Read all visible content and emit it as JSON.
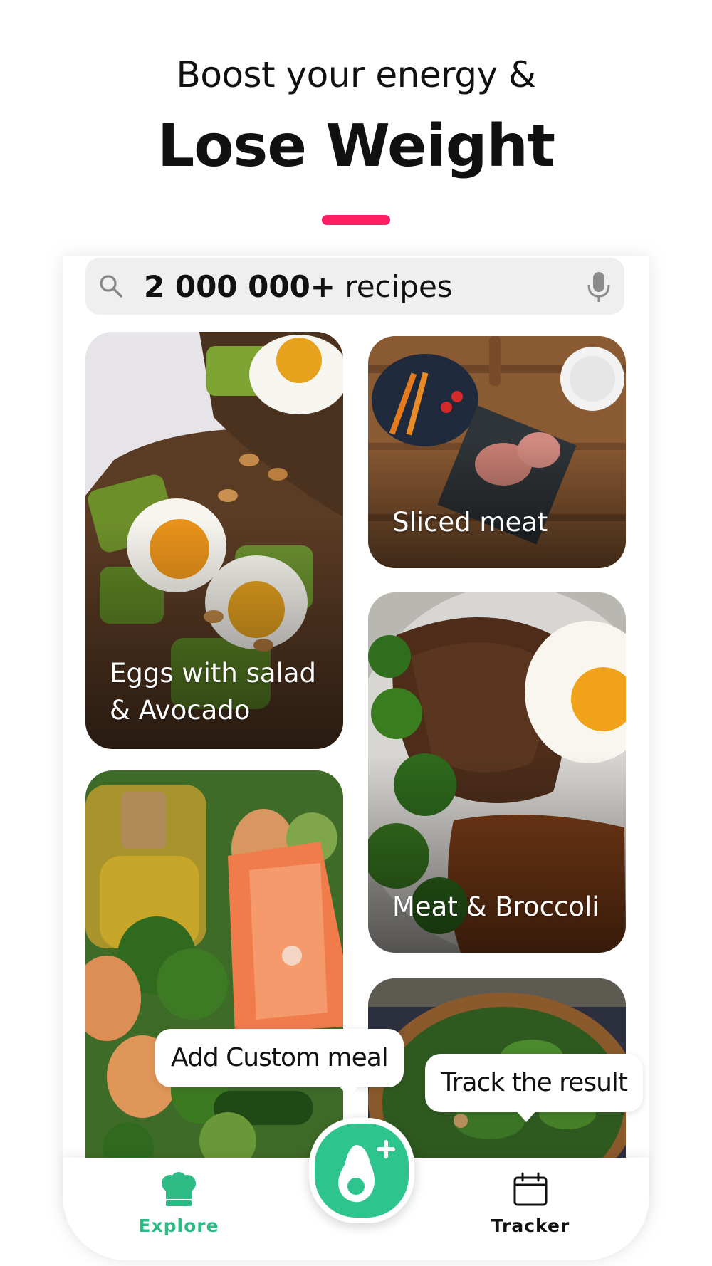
{
  "hero": {
    "line1": "Boost your energy &",
    "line2": "Lose Weight"
  },
  "search": {
    "count": "2 000 000+",
    "suffix": " recipes"
  },
  "cards": [
    {
      "label_line1": "Eggs with salad",
      "label_line2": "& Avocado"
    },
    {
      "label_line1": "Sliced meat",
      "label_line2": ""
    },
    {
      "label_line1": "Meat & Broccoli",
      "label_line2": ""
    },
    {
      "label_line1": "",
      "label_line2": ""
    },
    {
      "label_line1": "",
      "label_line2": ""
    }
  ],
  "bubbles": {
    "add_custom": "Add Custom meal",
    "track": "Track the result"
  },
  "tabbar": {
    "explore": "Explore",
    "tracker": "Tracker"
  },
  "colors": {
    "accent_pink": "#ff1e63",
    "brand_green": "#2dc48d",
    "tab_active": "#2dba85"
  },
  "icons": [
    "search-icon",
    "microphone-icon",
    "chef-hat-icon",
    "avocado-plus-icon",
    "calendar-icon"
  ]
}
